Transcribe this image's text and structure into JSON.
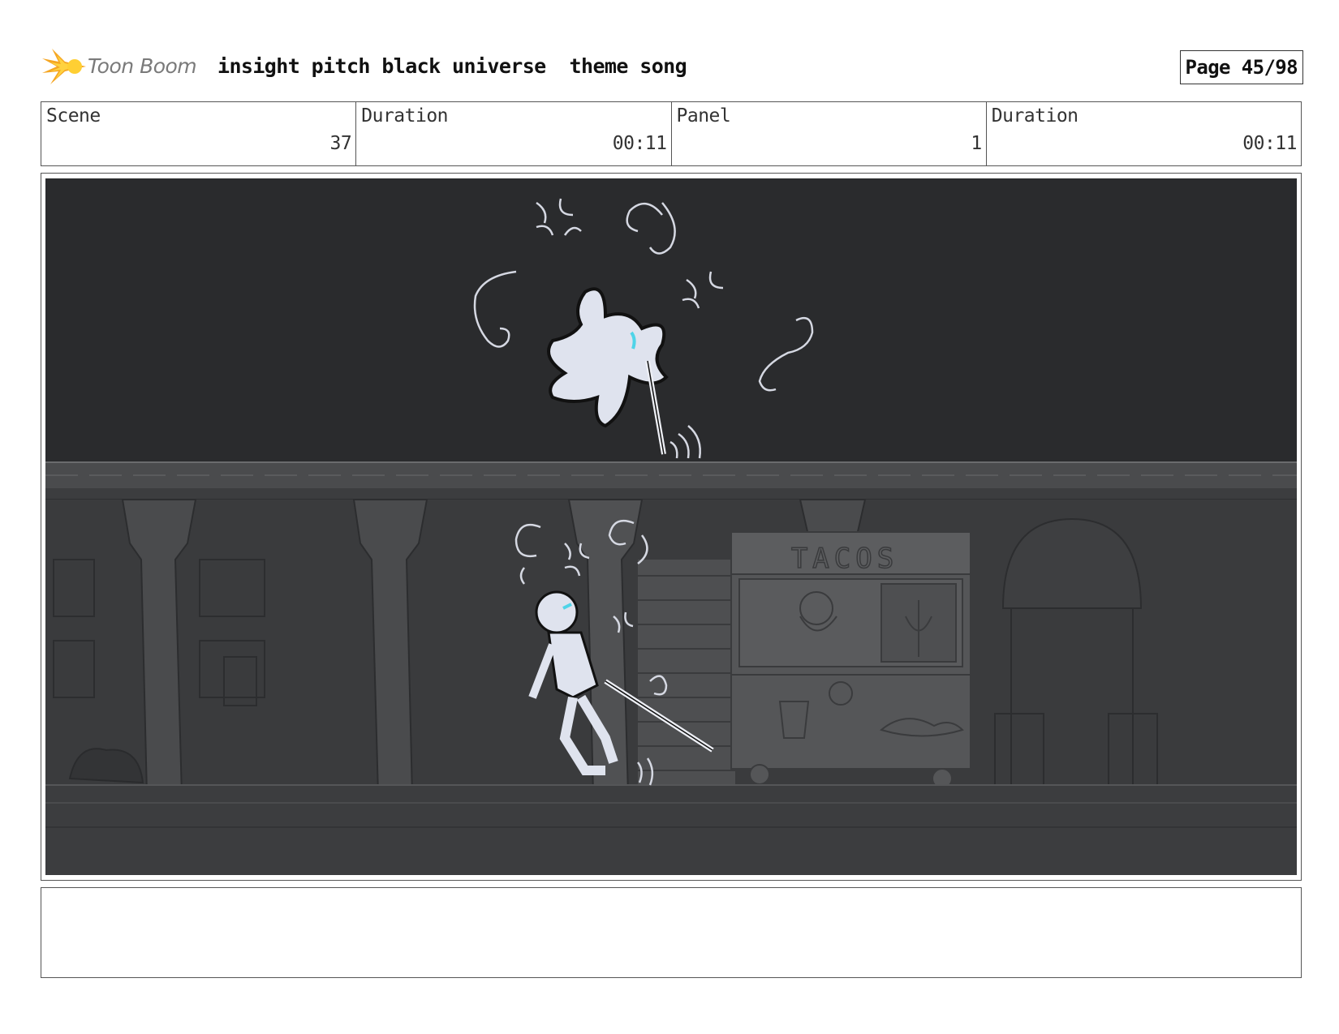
{
  "header": {
    "logo_text": "Toon Boom",
    "project_title": "insight pitch black universe  theme song",
    "page_label": "Page 45/98"
  },
  "info": {
    "scene_label": "Scene",
    "scene_value": "37",
    "scene_duration_label": "Duration",
    "scene_duration_value": "00:11",
    "panel_label": "Panel",
    "panel_value": "1",
    "panel_duration_label": "Duration",
    "panel_duration_value": "00:11"
  },
  "panel": {
    "sign_text": "TACOS"
  },
  "colors": {
    "logo_orange": "#f5a623",
    "logo_yellow": "#ffd23f",
    "sky": "#2a2b2d",
    "character_fill": "#dfe3ee",
    "accent_cyan": "#4fd4e8"
  }
}
